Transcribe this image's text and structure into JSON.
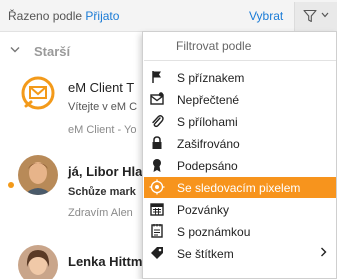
{
  "sortbar": {
    "label": "Řazeno podle",
    "value": "Přijato",
    "select": "Vybrat"
  },
  "group": {
    "title": "Starší"
  },
  "messages": [
    {
      "from": "eM Client T",
      "subject": "Vítejte v eM C",
      "preview": "eM Client - Yo",
      "unread": false
    },
    {
      "from": "já, Libor Hla",
      "subject": "Schůze mark",
      "preview": "Zdravím Alen",
      "unread": true
    },
    {
      "from": "Lenka Hittm",
      "subject": "",
      "preview": "",
      "unread": false
    }
  ],
  "menu": {
    "header": "Filtrovat podle",
    "items": [
      {
        "label": "S příznakem",
        "icon": "flag-icon"
      },
      {
        "label": "Nepřečtené",
        "icon": "unread-envelope-icon"
      },
      {
        "label": "S přílohami",
        "icon": "paperclip-icon"
      },
      {
        "label": "Zašifrováno",
        "icon": "lock-icon"
      },
      {
        "label": "Podepsáno",
        "icon": "signature-ribbon-icon"
      },
      {
        "label": "Se sledovacím pixelem",
        "icon": "tracking-target-icon",
        "active": true
      },
      {
        "label": "Pozvánky",
        "icon": "calendar-icon"
      },
      {
        "label": "S poznámkou",
        "icon": "note-icon"
      },
      {
        "label": "Se štítkem",
        "icon": "tag-icon",
        "submenu": true
      }
    ]
  },
  "colors": {
    "accent": "#f7941d",
    "link": "#1a7bd6",
    "unread_dot": "#f39a1a"
  }
}
